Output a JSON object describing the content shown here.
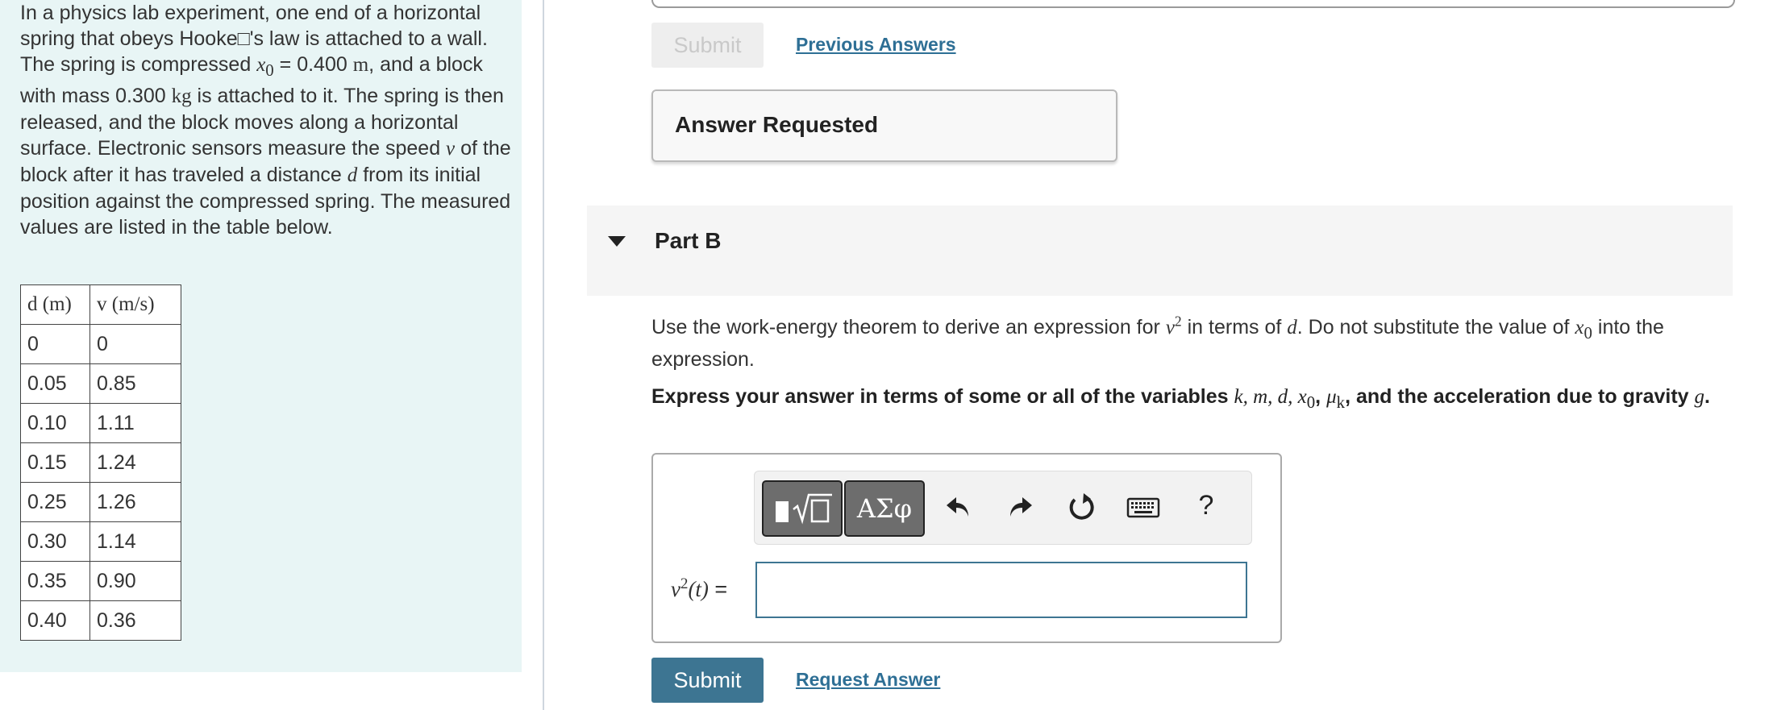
{
  "problem": {
    "intro_parts": {
      "p1": "In a physics lab experiment, one end of a horizontal spring that obeys Hooke□'s law is attached to a wall. The spring is compressed ",
      "x0": "x",
      "x0_sub": "0",
      "p2": " = 0.400 ",
      "unit_m": "m",
      "p3": ", and a block with mass 0.300 ",
      "unit_kg": "kg",
      "p4": " is attached to it. The spring is then released, and the block moves along a horizontal surface. Electronic sensors measure the speed ",
      "v": "v",
      "p5": " of the block after it has traveled a distance ",
      "d": "d",
      "p6": " from its initial position against the compressed spring. The measured values are listed in the table below."
    },
    "table": {
      "headers": [
        "d (m)",
        "v (m/s)"
      ],
      "rows": [
        [
          "0",
          "0"
        ],
        [
          "0.05",
          "0.85"
        ],
        [
          "0.10",
          "1.11"
        ],
        [
          "0.15",
          "1.24"
        ],
        [
          "0.25",
          "1.26"
        ],
        [
          "0.30",
          "1.14"
        ],
        [
          "0.35",
          "0.90"
        ],
        [
          "0.40",
          "0.36"
        ]
      ]
    }
  },
  "part_a": {
    "submit_label": "Submit",
    "previous_answers_label": "Previous Answers",
    "answer_requested_text": "Answer Requested"
  },
  "part_b": {
    "title": "Part B",
    "instruction": {
      "a": "Use the work-energy theorem to derive an expression for ",
      "v": "v",
      "sup2": "2",
      "b": " in terms of ",
      "d": "d",
      "c": ". Do not substitute the value of ",
      "x": "x",
      "x_sub": "0",
      "e": " into the expression."
    },
    "express": {
      "a": "Express your answer in terms of some or all of the variables ",
      "vars": "k, m, d, x",
      "vars_sub": "0",
      "comma": ", ",
      "mu": "μ",
      "mu_sub": "k",
      "b": ", and the acceleration due to gravity ",
      "g": "g",
      "c": "."
    },
    "toolbar": {
      "symbols_label": "ΑΣφ",
      "help_label": "?",
      "icons": [
        "templates-icon",
        "undo-icon",
        "redo-icon",
        "reset-icon",
        "keyboard-icon",
        "help-icon"
      ]
    },
    "answer_label": {
      "v": "v",
      "sup": "2",
      "paren": "(t)",
      "eq": " ="
    },
    "answer_value": "",
    "submit_label": "Submit",
    "request_answer_label": "Request Answer"
  },
  "colors": {
    "left_pane_bg": "#e8f5f5",
    "primary_button": "#3d7592",
    "link": "#2e6f95",
    "part_header_bg": "#f5f5f5"
  }
}
